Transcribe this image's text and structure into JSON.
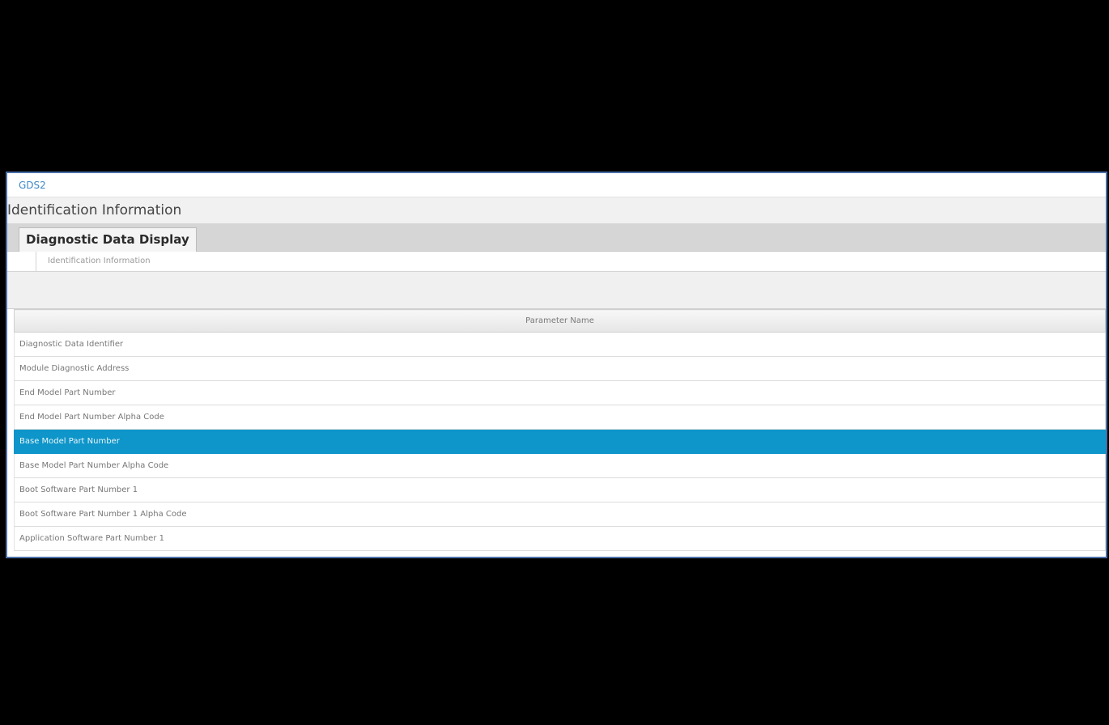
{
  "window": {
    "title": "GDS2"
  },
  "section": {
    "heading": "Identification Information"
  },
  "tabs": [
    {
      "label": "Diagnostic Data Display",
      "active": true
    }
  ],
  "breadcrumb": {
    "text": "Identification Information"
  },
  "table": {
    "column_header": "Parameter Name",
    "selected_color": "#0e95c9",
    "rows": [
      {
        "label": "Diagnostic Data Identifier",
        "selected": false
      },
      {
        "label": "Module Diagnostic Address",
        "selected": false
      },
      {
        "label": "End Model Part Number",
        "selected": false
      },
      {
        "label": "End Model Part Number Alpha Code",
        "selected": false
      },
      {
        "label": "Base Model Part Number",
        "selected": true
      },
      {
        "label": "Base Model Part Number Alpha Code",
        "selected": false
      },
      {
        "label": "Boot Software Part Number 1",
        "selected": false
      },
      {
        "label": "Boot Software Part Number 1 Alpha Code",
        "selected": false
      },
      {
        "label": "Application Software Part Number 1",
        "selected": false
      }
    ]
  }
}
